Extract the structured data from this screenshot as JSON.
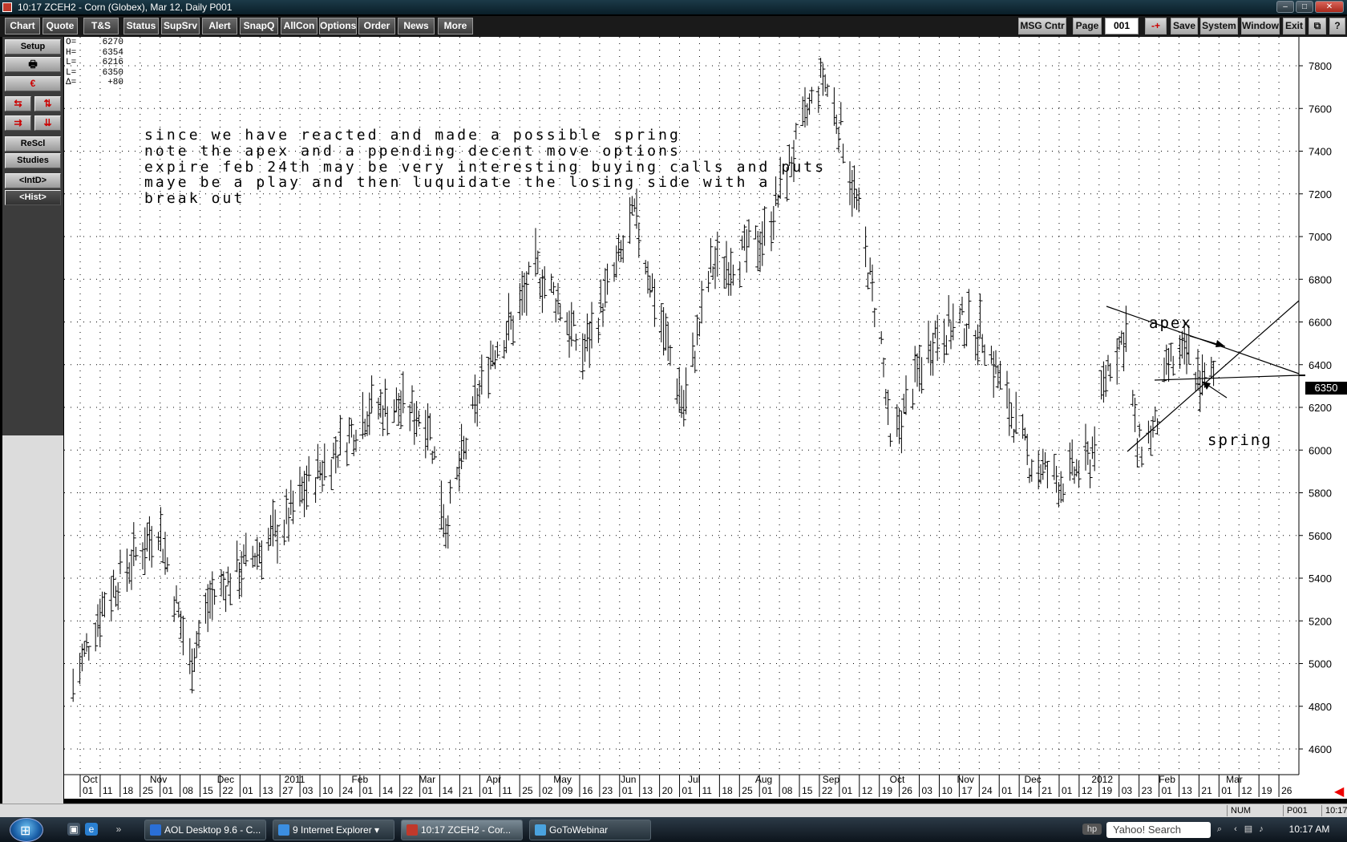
{
  "window": {
    "time": "10:17",
    "title": "ZCEH2 - Corn (Globex), Mar 12, Daily   P001"
  },
  "toolbar": {
    "left_buttons": [
      "Chart",
      "Quote",
      "T&S",
      "Status",
      "SupSrv",
      "Alert",
      "SnapQ",
      "AllCon",
      "Options",
      "Order",
      "News",
      "More"
    ],
    "msg_center": "MSG Cntr",
    "page_label": "Page",
    "page_value": "001",
    "nav_symbol": "-+",
    "right_buttons": [
      "Save",
      "System",
      "Window",
      "Exit"
    ],
    "restore_icon": "restore-icon",
    "help_label": "?"
  },
  "sidebar": {
    "setup": "Setup",
    "print_icon": "printer-icon",
    "erase_icon": "eraser-icon",
    "arrow_icons": [
      "swap-horizontal-icon",
      "swap-vertical-icon",
      "compress-horizontal-icon",
      "compress-vertical-icon"
    ],
    "rescale": "ReScl",
    "studies": "Studies",
    "intraday": "<IntD>",
    "history": "<Hist>"
  },
  "ohlc": [
    {
      "key": "O=",
      "value": "6270"
    },
    {
      "key": "H=",
      "value": "6354"
    },
    {
      "key": "L=",
      "value": "6216"
    },
    {
      "key": "L=",
      "value": "6350"
    },
    {
      "key": "Δ=",
      "value": "+80"
    }
  ],
  "annotations": {
    "note": "since we have reacted and made a possible spring\nnote the apex and a ppending decent move options\nexpire feb 24th may be very interesting buying calls and puts\nmaye be a play and then luquidate the losing side with a\nbreak out",
    "apex": "apex",
    "spring": "spring"
  },
  "chart_data": {
    "type": "ohlc-bar",
    "symbol": "ZCEH2",
    "y_axis": {
      "min": 4600,
      "max": 7800,
      "step": 200,
      "ticks": [
        "7800",
        "7600",
        "7400",
        "7200",
        "7000",
        "6800",
        "6600",
        "6400",
        "6200",
        "6000",
        "5800",
        "5600",
        "5400",
        "5200",
        "5000",
        "4800",
        "4600"
      ]
    },
    "current_price": "6350",
    "month_labels": [
      "Oct",
      "Nov",
      "Dec",
      "2011",
      "Feb",
      "Mar",
      "Apr",
      "May",
      "Jun",
      "Jul",
      "Aug",
      "Sep",
      "Oct",
      "Nov",
      "Dec",
      "2012",
      "Feb",
      "Mar"
    ],
    "day_labels": [
      "01",
      "11",
      "18",
      "25",
      "01",
      "08",
      "15",
      "22",
      "01",
      "13",
      "27",
      "03",
      "10",
      "24",
      "01",
      "14",
      "22",
      "01",
      "14",
      "21",
      "01",
      "11",
      "25",
      "02",
      "09",
      "16",
      "23",
      "01",
      "13",
      "20",
      "01",
      "11",
      "18",
      "25",
      "01",
      "08",
      "15",
      "22",
      "01",
      "12",
      "19",
      "26",
      "03",
      "10",
      "17",
      "24",
      "01",
      "14",
      "21",
      "01",
      "12",
      "19",
      "03",
      "23",
      "01",
      "13",
      "21",
      "01",
      "12",
      "19",
      "26"
    ],
    "series": [
      {
        "x": "2010-10-01",
        "y": 4900
      },
      {
        "x": "2010-10-15",
        "y": 5300
      },
      {
        "x": "2010-11-01",
        "y": 5550
      },
      {
        "x": "2010-11-08",
        "y": 5650
      },
      {
        "x": "2010-11-22",
        "y": 5000
      },
      {
        "x": "2010-12-01",
        "y": 5300
      },
      {
        "x": "2010-12-15",
        "y": 5450
      },
      {
        "x": "2011-01-03",
        "y": 5650
      },
      {
        "x": "2011-01-14",
        "y": 5850
      },
      {
        "x": "2011-01-27",
        "y": 6000
      },
      {
        "x": "2011-02-10",
        "y": 6200
      },
      {
        "x": "2011-02-24",
        "y": 6200
      },
      {
        "x": "2011-03-08",
        "y": 6150
      },
      {
        "x": "2011-03-16",
        "y": 5650
      },
      {
        "x": "2011-03-28",
        "y": 6150
      },
      {
        "x": "2011-04-05",
        "y": 6450
      },
      {
        "x": "2011-04-15",
        "y": 6600
      },
      {
        "x": "2011-04-25",
        "y": 6850
      },
      {
        "x": "2011-05-05",
        "y": 6700
      },
      {
        "x": "2011-05-16",
        "y": 6450
      },
      {
        "x": "2011-05-31",
        "y": 6850
      },
      {
        "x": "2011-06-08",
        "y": 7100
      },
      {
        "x": "2011-06-20",
        "y": 6600
      },
      {
        "x": "2011-06-30",
        "y": 6200
      },
      {
        "x": "2011-07-12",
        "y": 6850
      },
      {
        "x": "2011-07-25",
        "y": 6900
      },
      {
        "x": "2011-08-05",
        "y": 7000
      },
      {
        "x": "2011-08-15",
        "y": 7300
      },
      {
        "x": "2011-08-25",
        "y": 7600
      },
      {
        "x": "2011-08-31",
        "y": 7750
      },
      {
        "x": "2011-09-08",
        "y": 7500
      },
      {
        "x": "2011-09-16",
        "y": 7100
      },
      {
        "x": "2011-09-26",
        "y": 6500
      },
      {
        "x": "2011-09-30",
        "y": 6000
      },
      {
        "x": "2011-10-10",
        "y": 6300
      },
      {
        "x": "2011-10-20",
        "y": 6550
      },
      {
        "x": "2011-11-01",
        "y": 6600
      },
      {
        "x": "2011-11-10",
        "y": 6550
      },
      {
        "x": "2011-11-22",
        "y": 6200
      },
      {
        "x": "2011-12-01",
        "y": 5950
      },
      {
        "x": "2011-12-15",
        "y": 5850
      },
      {
        "x": "2011-12-28",
        "y": 5950
      },
      {
        "x": "2012-01-05",
        "y": 6400
      },
      {
        "x": "2012-01-13",
        "y": 6550
      },
      {
        "x": "2012-01-18",
        "y": 6000
      },
      {
        "x": "2012-01-26",
        "y": 6100
      },
      {
        "x": "2012-02-01",
        "y": 6400
      },
      {
        "x": "2012-02-10",
        "y": 6450
      },
      {
        "x": "2012-02-16",
        "y": 6300
      },
      {
        "x": "2012-02-21",
        "y": 6350
      }
    ]
  },
  "statusbar": {
    "num": "NUM",
    "page": "P001",
    "time": "10:17"
  },
  "taskbar": {
    "start_icon": "windows-orb-icon",
    "tasks": [
      {
        "label": "AOL Desktop 9.6 - C...",
        "color": "#2a6fd6"
      },
      {
        "label": "9 Internet Explorer",
        "color": "#3b8ee0"
      },
      {
        "label": "10:17  ZCEH2 - Cor...",
        "color": "#c0392b"
      },
      {
        "label": "GoToWebinar",
        "color": "#4aa3df"
      }
    ],
    "search": "Yahoo! Search",
    "clock": "10:17 AM"
  }
}
